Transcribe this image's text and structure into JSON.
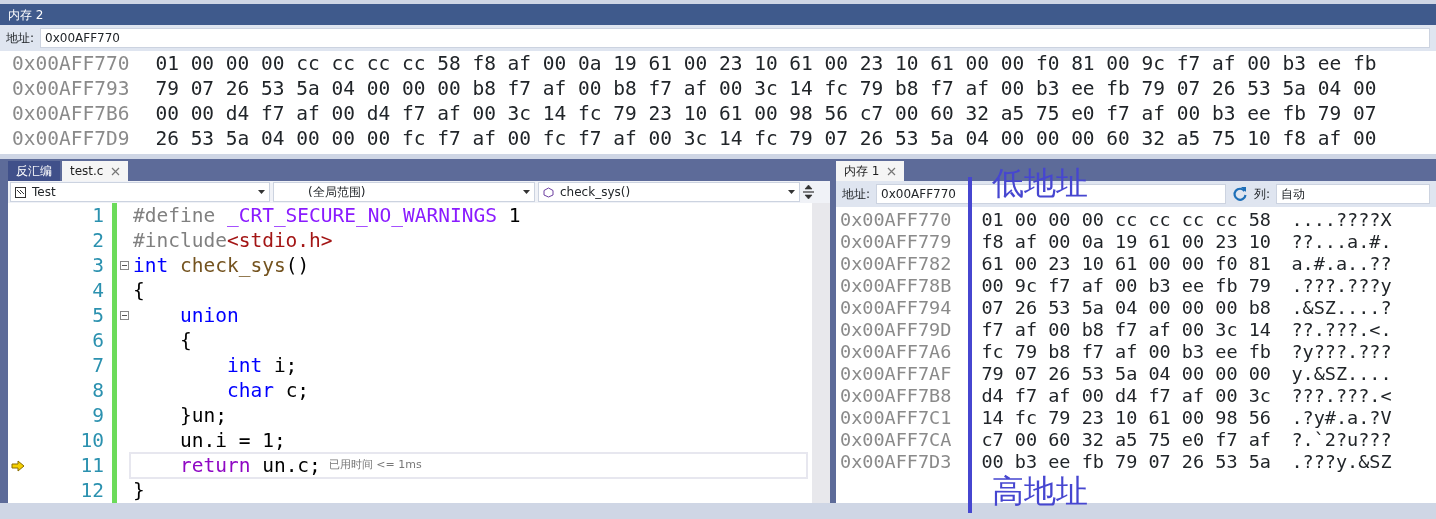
{
  "memory_top": {
    "title": "内存 2",
    "address_label": "地址:",
    "address": "0x00AFF770",
    "rows": [
      {
        "address": "0x00AFF770",
        "bytes": "01 00 00 00 cc cc cc cc 58 f8 af 00 0a 19 61 00 23 10 61 00 23 10 61 00 00 f0 81 00 9c f7 af 00 b3 ee fb"
      },
      {
        "address": "0x00AFF793",
        "bytes": "79 07 26 53 5a 04 00 00 00 b8 f7 af 00 b8 f7 af 00 3c 14 fc 79 b8 f7 af 00 b3 ee fb 79 07 26 53 5a 04 00"
      },
      {
        "address": "0x00AFF7B6",
        "bytes": "00 00 d4 f7 af 00 d4 f7 af 00 3c 14 fc 79 23 10 61 00 98 56 c7 00 60 32 a5 75 e0 f7 af 00 b3 ee fb 79 07"
      },
      {
        "address": "0x00AFF7D9",
        "bytes": "26 53 5a 04 00 00 00 fc f7 af 00 fc f7 af 00 3c 14 fc 79 07 26 53 5a 04 00 00 00 60 32 a5 75 10 f8 af 00"
      }
    ]
  },
  "editor": {
    "tabs": [
      {
        "label": "反汇编",
        "selected": false,
        "closable": false
      },
      {
        "label": "test.c",
        "selected": true,
        "closable": true
      }
    ],
    "project": "Test",
    "scope": "(全局范围)",
    "function": "check_sys()",
    "lines": [
      {
        "number": "1",
        "current": false,
        "collapsible": false,
        "tokens": [
          {
            "kind": "preproc",
            "text": "#define "
          },
          {
            "kind": "macro",
            "text": "_CRT_SECURE_NO_WARNINGS"
          },
          {
            "kind": "plain",
            "text": " 1"
          }
        ]
      },
      {
        "number": "2",
        "current": false,
        "collapsible": false,
        "tokens": [
          {
            "kind": "preproc",
            "text": "#include"
          },
          {
            "kind": "string",
            "text": "<stdio.h>"
          }
        ]
      },
      {
        "number": "3",
        "current": false,
        "collapsible": true,
        "tokens": [
          {
            "kind": "keyword",
            "text": "int"
          },
          {
            "kind": "function",
            "text": " check_sys"
          },
          {
            "kind": "plain",
            "text": "()"
          }
        ]
      },
      {
        "number": "4",
        "current": false,
        "collapsible": false,
        "tokens": [
          {
            "kind": "plain",
            "text": "{"
          }
        ]
      },
      {
        "number": "5",
        "current": false,
        "collapsible": true,
        "tokens": [
          {
            "kind": "keyword",
            "text": "    union"
          }
        ]
      },
      {
        "number": "6",
        "current": false,
        "collapsible": false,
        "tokens": [
          {
            "kind": "plain",
            "text": "    {"
          }
        ]
      },
      {
        "number": "7",
        "current": false,
        "collapsible": false,
        "tokens": [
          {
            "kind": "keyword",
            "text": "        int"
          },
          {
            "kind": "plain",
            "text": " i;"
          }
        ]
      },
      {
        "number": "8",
        "current": false,
        "collapsible": false,
        "tokens": [
          {
            "kind": "keyword",
            "text": "        char"
          },
          {
            "kind": "plain",
            "text": " c;"
          }
        ]
      },
      {
        "number": "9",
        "current": false,
        "collapsible": false,
        "tokens": [
          {
            "kind": "plain",
            "text": "    }un;"
          }
        ]
      },
      {
        "number": "10",
        "current": false,
        "collapsible": false,
        "tokens": [
          {
            "kind": "plain",
            "text": "    un.i = 1;"
          }
        ]
      },
      {
        "number": "11",
        "current": true,
        "collapsible": false,
        "hint": "已用时间 <= 1ms",
        "tokens": [
          {
            "kind": "control",
            "text": "    return"
          },
          {
            "kind": "plain",
            "text": " un.c;"
          }
        ]
      },
      {
        "number": "12",
        "current": false,
        "collapsible": false,
        "tokens": [
          {
            "kind": "plain",
            "text": "}"
          }
        ]
      }
    ]
  },
  "memory_right": {
    "tabs": [
      {
        "label": "内存 1",
        "selected": true,
        "closable": true
      }
    ],
    "address_label": "地址:",
    "address": "0x00AFF770",
    "columns_label": "列:",
    "columns": "自动",
    "rows": [
      {
        "address": "0x00AFF770",
        "bytes": "01 00 00 00 cc cc cc cc 58",
        "chars": "....????X"
      },
      {
        "address": "0x00AFF779",
        "bytes": "f8 af 00 0a 19 61 00 23 10",
        "chars": "??...a.#."
      },
      {
        "address": "0x00AFF782",
        "bytes": "61 00 23 10 61 00 00 f0 81",
        "chars": "a.#.a..??"
      },
      {
        "address": "0x00AFF78B",
        "bytes": "00 9c f7 af 00 b3 ee fb 79",
        "chars": ".???.???y"
      },
      {
        "address": "0x00AFF794",
        "bytes": "07 26 53 5a 04 00 00 00 b8",
        "chars": ".&SZ....?"
      },
      {
        "address": "0x00AFF79D",
        "bytes": "f7 af 00 b8 f7 af 00 3c 14",
        "chars": "??.???.<."
      },
      {
        "address": "0x00AFF7A6",
        "bytes": "fc 79 b8 f7 af 00 b3 ee fb",
        "chars": "?y???.???"
      },
      {
        "address": "0x00AFF7AF",
        "bytes": "79 07 26 53 5a 04 00 00 00",
        "chars": "y.&SZ...."
      },
      {
        "address": "0x00AFF7B8",
        "bytes": "d4 f7 af 00 d4 f7 af 00 3c",
        "chars": "???.???.<"
      },
      {
        "address": "0x00AFF7C1",
        "bytes": "14 fc 79 23 10 61 00 98 56",
        "chars": ".?y#.a.?V"
      },
      {
        "address": "0x00AFF7CA",
        "bytes": "c7 00 60 32 a5 75 e0 f7 af",
        "chars": "?.`2?u???"
      },
      {
        "address": "0x00AFF7D3",
        "bytes": "00 b3 ee fb 79 07 26 53 5a",
        "chars": ".???y.&SZ"
      }
    ],
    "annotations": [
      {
        "kind": "top",
        "text": "低地址"
      },
      {
        "kind": "bottom",
        "text": "高地址"
      }
    ]
  }
}
